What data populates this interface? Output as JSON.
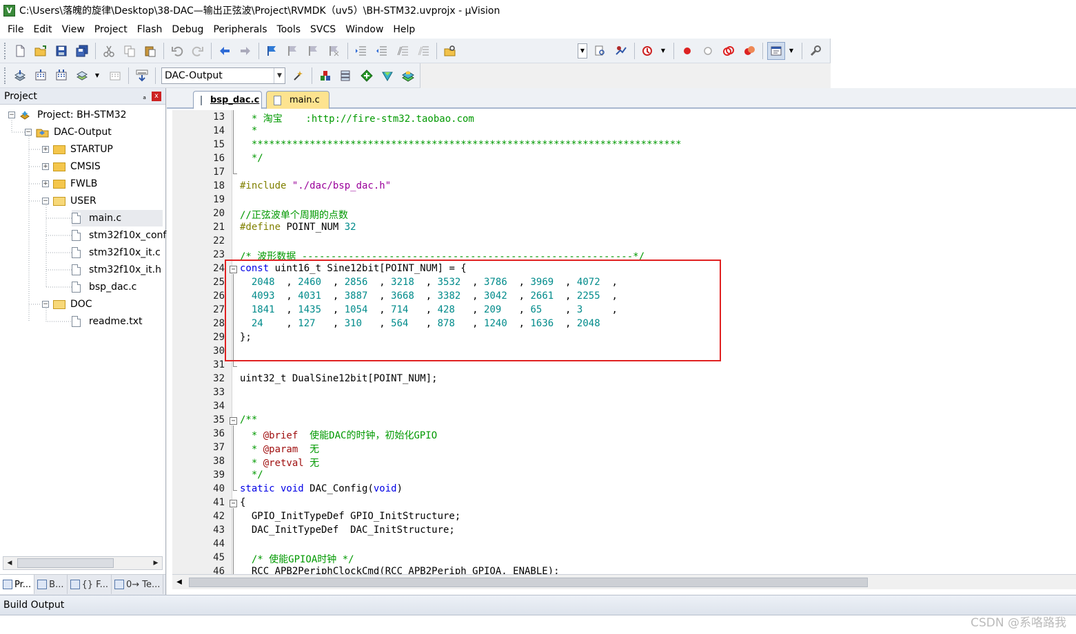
{
  "window": {
    "title": "C:\\Users\\落魄的旋律\\Desktop\\38-DAC—输出正弦波\\Project\\RVMDK（uv5）\\BH-STM32.uvprojx - µVision",
    "app_icon_letter": "V"
  },
  "menu": [
    "File",
    "Edit",
    "View",
    "Project",
    "Flash",
    "Debug",
    "Peripherals",
    "Tools",
    "SVCS",
    "Window",
    "Help"
  ],
  "toolbar2": {
    "target": "DAC-Output"
  },
  "project_panel": {
    "title": "Project",
    "pin_glyph": "ₐ",
    "close_glyph": "x",
    "tree": [
      {
        "label": "Project: BH-STM32",
        "level": 0,
        "type": "project",
        "expand": "−"
      },
      {
        "label": "DAC-Output",
        "level": 1,
        "type": "target",
        "expand": "−"
      },
      {
        "label": "STARTUP",
        "level": 2,
        "type": "folder",
        "expand": "+"
      },
      {
        "label": "CMSIS",
        "level": 2,
        "type": "folder",
        "expand": "+"
      },
      {
        "label": "FWLB",
        "level": 2,
        "type": "folder",
        "expand": "+"
      },
      {
        "label": "USER",
        "level": 2,
        "type": "folder-open",
        "expand": "−"
      },
      {
        "label": "main.c",
        "level": 3,
        "type": "file",
        "selected": true
      },
      {
        "label": "stm32f10x_conf",
        "level": 3,
        "type": "file"
      },
      {
        "label": "stm32f10x_it.c",
        "level": 3,
        "type": "file"
      },
      {
        "label": "stm32f10x_it.h",
        "level": 3,
        "type": "file"
      },
      {
        "label": "bsp_dac.c",
        "level": 3,
        "type": "file"
      },
      {
        "label": "DOC",
        "level": 2,
        "type": "folder-open",
        "expand": "−"
      },
      {
        "label": "readme.txt",
        "level": 3,
        "type": "file"
      }
    ],
    "tabs": [
      {
        "label": "Pr...",
        "active": true
      },
      {
        "label": "B...",
        "active": false
      },
      {
        "label": "{} F...",
        "active": false
      },
      {
        "label": "0→ Te...",
        "active": false
      }
    ]
  },
  "editor": {
    "tabs": [
      {
        "label": "bsp_dac.c",
        "active": true
      },
      {
        "label": "main.c",
        "active": false
      }
    ],
    "lines": [
      {
        "n": "13",
        "t": [
          [
            "c-green",
            "  * 淘宝    :http://fire-stm32.taobao.com"
          ]
        ]
      },
      {
        "n": "14",
        "t": [
          [
            "c-green",
            "  *"
          ]
        ]
      },
      {
        "n": "15",
        "t": [
          [
            "c-green",
            "  **************************************************************************"
          ]
        ]
      },
      {
        "n": "16",
        "t": [
          [
            "c-green",
            "  */"
          ]
        ]
      },
      {
        "n": "17",
        "t": []
      },
      {
        "n": "18",
        "t": [
          [
            "c-pp",
            "#include "
          ],
          [
            "c-str",
            "\"./dac/bsp_dac.h\""
          ]
        ]
      },
      {
        "n": "19",
        "t": []
      },
      {
        "n": "20",
        "t": [
          [
            "c-green",
            "//正弦波单个周期的点数"
          ]
        ]
      },
      {
        "n": "21",
        "t": [
          [
            "c-pp",
            "#define "
          ],
          [
            "",
            "POINT_NUM "
          ],
          [
            "c-num",
            "32"
          ]
        ]
      },
      {
        "n": "22",
        "t": []
      },
      {
        "n": "23",
        "t": [
          [
            "c-green",
            "/* 波形数据 ---------------------------------------------------------*/"
          ]
        ]
      },
      {
        "n": "24",
        "t": [
          [
            "c-blue",
            "const "
          ],
          [
            "",
            "uint16_t Sine12bit[POINT_NUM] = {"
          ]
        ],
        "fold": "−"
      },
      {
        "n": "25",
        "t": [
          [
            "c-num",
            "  2048"
          ],
          [
            "",
            "  , "
          ],
          [
            "c-num",
            "2460"
          ],
          [
            "",
            "  , "
          ],
          [
            "c-num",
            "2856"
          ],
          [
            "",
            "  , "
          ],
          [
            "c-num",
            "3218"
          ],
          [
            "",
            "  , "
          ],
          [
            "c-num",
            "3532"
          ],
          [
            "",
            "  , "
          ],
          [
            "c-num",
            "3786"
          ],
          [
            "",
            "  , "
          ],
          [
            "c-num",
            "3969"
          ],
          [
            "",
            "  , "
          ],
          [
            "c-num",
            "4072"
          ],
          [
            "",
            "  ,"
          ]
        ]
      },
      {
        "n": "26",
        "t": [
          [
            "c-num",
            "  4093"
          ],
          [
            "",
            "  , "
          ],
          [
            "c-num",
            "4031"
          ],
          [
            "",
            "  , "
          ],
          [
            "c-num",
            "3887"
          ],
          [
            "",
            "  , "
          ],
          [
            "c-num",
            "3668"
          ],
          [
            "",
            "  , "
          ],
          [
            "c-num",
            "3382"
          ],
          [
            "",
            "  , "
          ],
          [
            "c-num",
            "3042"
          ],
          [
            "",
            "  , "
          ],
          [
            "c-num",
            "2661"
          ],
          [
            "",
            "  , "
          ],
          [
            "c-num",
            "2255"
          ],
          [
            "",
            "  ,"
          ]
        ]
      },
      {
        "n": "27",
        "t": [
          [
            "c-num",
            "  1841"
          ],
          [
            "",
            "  , "
          ],
          [
            "c-num",
            "1435"
          ],
          [
            "",
            "  , "
          ],
          [
            "c-num",
            "1054"
          ],
          [
            "",
            "  , "
          ],
          [
            "c-num",
            "714 "
          ],
          [
            "",
            "  , "
          ],
          [
            "c-num",
            "428 "
          ],
          [
            "",
            "  , "
          ],
          [
            "c-num",
            "209 "
          ],
          [
            "",
            "  , "
          ],
          [
            "c-num",
            "65  "
          ],
          [
            "",
            "  , "
          ],
          [
            "c-num",
            "3   "
          ],
          [
            "",
            "  ,"
          ]
        ]
      },
      {
        "n": "28",
        "t": [
          [
            "c-num",
            "  24  "
          ],
          [
            "",
            "  , "
          ],
          [
            "c-num",
            "127 "
          ],
          [
            "",
            "  , "
          ],
          [
            "c-num",
            "310 "
          ],
          [
            "",
            "  , "
          ],
          [
            "c-num",
            "564 "
          ],
          [
            "",
            "  , "
          ],
          [
            "c-num",
            "878 "
          ],
          [
            "",
            "  , "
          ],
          [
            "c-num",
            "1240"
          ],
          [
            "",
            "  , "
          ],
          [
            "c-num",
            "1636"
          ],
          [
            "",
            "  , "
          ],
          [
            "c-num",
            "2048"
          ]
        ]
      },
      {
        "n": "29",
        "t": [
          [
            "",
            "};"
          ]
        ]
      },
      {
        "n": "30",
        "t": []
      },
      {
        "n": "31",
        "t": []
      },
      {
        "n": "32",
        "t": [
          [
            "",
            "uint32_t DualSine12bit[POINT_NUM];"
          ]
        ]
      },
      {
        "n": "33",
        "t": []
      },
      {
        "n": "34",
        "t": []
      },
      {
        "n": "35",
        "t": [
          [
            "c-green",
            "/**"
          ]
        ],
        "fold": "−"
      },
      {
        "n": "36",
        "t": [
          [
            "c-green",
            "  * "
          ],
          [
            "c-mag",
            "@brief"
          ],
          [
            "c-green",
            "  使能DAC的时钟，初始化GPIO"
          ]
        ]
      },
      {
        "n": "37",
        "t": [
          [
            "c-green",
            "  * "
          ],
          [
            "c-mag",
            "@param"
          ],
          [
            "c-green",
            "  无"
          ]
        ]
      },
      {
        "n": "38",
        "t": [
          [
            "c-green",
            "  * "
          ],
          [
            "c-mag",
            "@retval"
          ],
          [
            "c-green",
            " 无"
          ]
        ]
      },
      {
        "n": "39",
        "t": [
          [
            "c-green",
            "  */"
          ]
        ]
      },
      {
        "n": "40",
        "t": [
          [
            "c-blue",
            "static void "
          ],
          [
            "",
            "DAC_Config("
          ],
          [
            "c-blue",
            "void"
          ],
          [
            "",
            ")"
          ]
        ]
      },
      {
        "n": "41",
        "t": [
          [
            "",
            "{"
          ]
        ],
        "fold": "−"
      },
      {
        "n": "42",
        "t": [
          [
            "",
            "  GPIO_InitTypeDef GPIO_InitStructure;"
          ]
        ]
      },
      {
        "n": "43",
        "t": [
          [
            "",
            "  DAC_InitTypeDef  DAC_InitStructure;"
          ]
        ]
      },
      {
        "n": "44",
        "t": []
      },
      {
        "n": "45",
        "t": [
          [
            "c-green",
            "  /* 使能GPIOA时钟 */"
          ]
        ]
      },
      {
        "n": "46",
        "t": [
          [
            "",
            "  RCC_APB2PeriphClockCmd(RCC_APB2Periph_GPIOA, ENABLE);"
          ]
        ]
      }
    ]
  },
  "build_output": {
    "title": "Build Output"
  },
  "watermark": "CSDN @系咯路我"
}
